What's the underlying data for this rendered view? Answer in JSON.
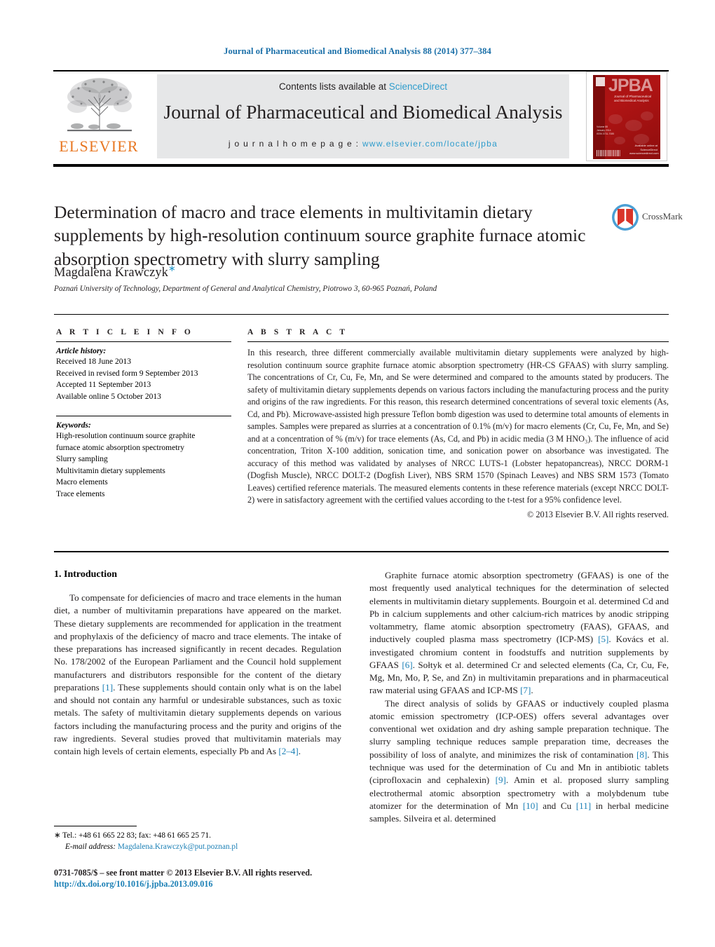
{
  "running_head": "Journal of Pharmaceutical and Biomedical Analysis 88 (2014) 377–384",
  "masthead": {
    "contents_prefix": "Contents lists available at ",
    "contents_link": "ScienceDirect",
    "journal_title": "Journal of Pharmaceutical and Biomedical Analysis",
    "homepage_prefix": "j o u r n a l   h o m e p a g e :   ",
    "homepage_url": "www.elsevier.com/locate/jpba",
    "publisher_logo_text": "ELSEVIER",
    "cover": {
      "acronym": "JPBA",
      "subtitle": "Journal of Pharmaceutical and Biomedical Analysis",
      "meta": "Volume 88\nJanuary 2014\nISSN 0731-7085",
      "sciencedirect_label": "Available online at\nScienceDirect\nwww.sciencedirect.com"
    }
  },
  "article": {
    "title": "Determination of macro and trace elements in multivitamin dietary supplements by high-resolution continuum source graphite furnace atomic absorption spectrometry with slurry sampling",
    "author": "Magdalena Krawczyk",
    "author_marker": "∗",
    "affiliation": "Poznań University of Technology, Department of General and Analytical Chemistry, Piotrowo 3, 60-965 Poznań, Poland",
    "crossmark_label": "CrossMark"
  },
  "article_info": {
    "heading": "A R T I C L E   I N F O",
    "history_label": "Article history:",
    "history": [
      "Received 18 June 2013",
      "Received in revised form 9 September 2013",
      "Accepted 11 September 2013",
      "Available online 5 October 2013"
    ],
    "keywords_label": "Keywords:",
    "keywords": [
      "High-resolution continuum source graphite",
      "furnace atomic absorption spectrometry",
      "Slurry sampling",
      "Multivitamin dietary supplements",
      "Macro elements",
      "Trace elements"
    ]
  },
  "abstract": {
    "heading": "A B S T R A C T",
    "text": "In this research, three different commercially available multivitamin dietary supplements were analyzed by high-resolution continuum source graphite furnace atomic absorption spectrometry (HR-CS GFAAS) with slurry sampling. The concentrations of Cr, Cu, Fe, Mn, and Se were determined and compared to the amounts stated by producers. The safety of multivitamin dietary supplements depends on various factors including the manufacturing process and the purity and origins of the raw ingredients. For this reason, this research determined concentrations of several toxic elements (As, Cd, and Pb). Microwave-assisted high pressure Teflon bomb digestion was used to determine total amounts of elements in samples. Samples were prepared as slurries at a concentration of 0.1% (m/v) for macro elements (Cr, Cu, Fe, Mn, and Se) and at a concentration of % (m/v) for trace elements (As, Cd, and Pb) in acidic media (3 M HNO₃). The influence of acid concentration, Triton X-100 addition, sonication time, and sonication power on absorbance was investigated. The accuracy of this method was validated by analyses of NRCC LUTS-1 (Lobster hepatopancreas), NRCC DORM-1 (Dogfish Muscle), NRCC DOLT-2 (Dogfish Liver), NBS SRM 1570 (Spinach Leaves) and NBS SRM 1573 (Tomato Leaves) certified reference materials. The measured elements contents in these reference materials (except NRCC DOLT-2) were in satisfactory agreement with the certified values according to the t-test for a 95% confidence level.",
    "copyright": "© 2013 Elsevier B.V. All rights reserved."
  },
  "introduction": {
    "heading": "1.  Introduction",
    "left_paragraph_1": "To compensate for deficiencies of macro and trace elements in the human diet, a number of multivitamin preparations have appeared on the market. These dietary supplements are recommended for application in the treatment and prophylaxis of the deficiency of macro and trace elements. The intake of these preparations has increased significantly in recent decades. Regulation No. 178/2002 of the European Parliament and the Council hold supplement manufacturers and distributors responsible for the content of the dietary preparations [1]. These supplements should contain only what is on the label and should not contain any harmful or undesirable substances, such as toxic metals. The safety of multivitamin dietary supplements depends on various factors including the manufacturing process and the purity and origins of the raw ingredients. Several studies proved that multivitamin materials may contain high levels of certain elements, especially Pb and As [2–4].",
    "right_paragraph_1": "Graphite furnace atomic absorption spectrometry (GFAAS) is one of the most frequently used analytical techniques for the determination of selected elements in multivitamin dietary supplements. Bourgoin et al. determined Cd and Pb in calcium supplements and other calcium-rich matrices by anodic stripping voltammetry, flame atomic absorption spectrometry (FAAS), GFAAS, and inductively coupled plasma mass spectrometry (ICP-MS) [5]. Kovács et al. investigated chromium content in foodstuffs and nutrition supplements by GFAAS [6]. Sołtyk et al. determined Cr and selected elements (Ca, Cr, Cu, Fe, Mg, Mn, Mo, P, Se, and Zn) in multivitamin preparations and in pharmaceutical raw material using GFAAS and ICP-MS [7].",
    "right_paragraph_2": "The direct analysis of solids by GFAAS or inductively coupled plasma atomic emission spectrometry (ICP-OES) offers several advantages over conventional wet oxidation and dry ashing sample preparation technique. The slurry sampling technique reduces sample preparation time, decreases the possibility of loss of analyte, and minimizes the risk of contamination [8]. This technique was used for the determination of Cu and Mn in antibiotic tablets (ciprofloxacin and cephalexin) [9]. Amin et al. proposed slurry sampling electrothermal atomic absorption spectrometry with a molybdenum tube atomizer for the determination of Mn [10] and Cu [11] in herbal medicine samples. Silveira et al. determined"
  },
  "footnote": {
    "marker": "∗",
    "contact": "Tel.: +48 61 665 22 83; fax: +48 61 665 25 71.",
    "email_label": "E-mail address:",
    "email": "Magdalena.Krawczyk@put.poznan.pl"
  },
  "colophon": {
    "issn_line": "0731-7085/$ – see front matter © 2013 Elsevier B.V. All rights reserved.",
    "doi": "http://dx.doi.org/10.1016/j.jpba.2013.09.016"
  },
  "colors": {
    "link": "#1a7fb5",
    "sciencedirect": "#2e9ccc",
    "elsevier_orange": "#E87722",
    "cover_red": "#a51111"
  }
}
